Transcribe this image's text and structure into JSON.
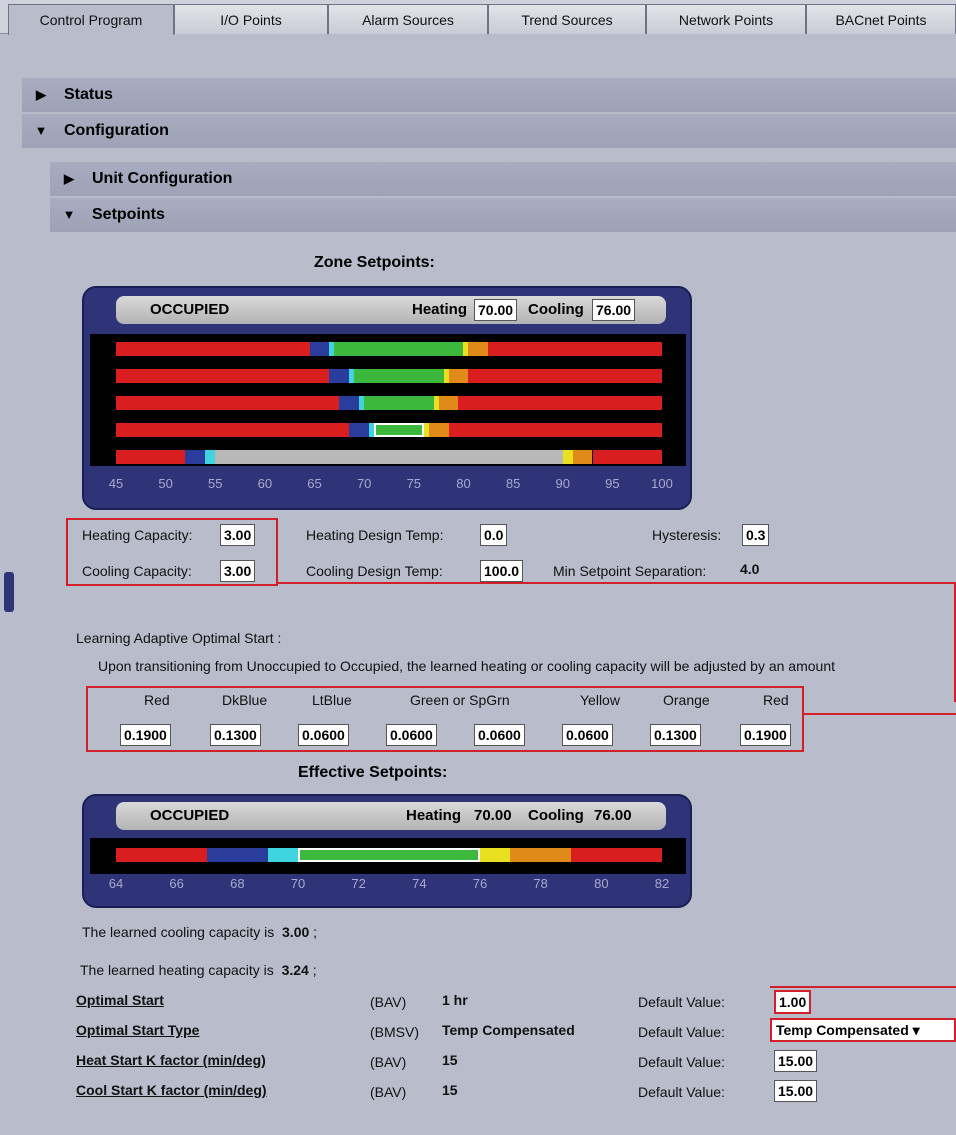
{
  "tabs": [
    "Control Program",
    "I/O Points",
    "Alarm Sources",
    "Trend Sources",
    "Network Points",
    "BACnet Points"
  ],
  "sections": {
    "status": "Status",
    "configuration": "Configuration",
    "unit_config": "Unit Configuration",
    "setpoints": "Setpoints"
  },
  "zone": {
    "title": "Zone Setpoints:",
    "mode": "OCCUPIED",
    "heating_label": "Heating",
    "heating": "70.00",
    "cooling_label": "Cooling",
    "cooling": "76.00",
    "ticks": [
      "45",
      "50",
      "55",
      "60",
      "65",
      "70",
      "75",
      "80",
      "85",
      "90",
      "95",
      "100"
    ],
    "axis_min": 45,
    "axis_max": 100,
    "rows": [
      {
        "segs": [
          [
            "red",
            45,
            64.5
          ],
          [
            "blue",
            64.5,
            66.5
          ],
          [
            "cyan",
            66.5,
            67
          ],
          [
            "green",
            67,
            80
          ],
          [
            "yellow",
            80,
            80.5
          ],
          [
            "orange",
            80.5,
            82.5
          ],
          [
            "red",
            82.5,
            100
          ]
        ]
      },
      {
        "segs": [
          [
            "red",
            45,
            66.5
          ],
          [
            "blue",
            66.5,
            68.5
          ],
          [
            "cyan",
            68.5,
            69
          ],
          [
            "green",
            69,
            78
          ],
          [
            "yellow",
            78,
            78.5
          ],
          [
            "orange",
            78.5,
            80.5
          ],
          [
            "red",
            80.5,
            100
          ]
        ]
      },
      {
        "segs": [
          [
            "red",
            45,
            67.5
          ],
          [
            "blue",
            67.5,
            69.5
          ],
          [
            "cyan",
            69.5,
            70
          ],
          [
            "green",
            70,
            77
          ],
          [
            "yellow",
            77,
            77.5
          ],
          [
            "orange",
            77.5,
            79.5
          ],
          [
            "red",
            79.5,
            100
          ]
        ]
      },
      {
        "segs": [
          [
            "red",
            45,
            68.5
          ],
          [
            "blue",
            68.5,
            70.5
          ],
          [
            "cyan",
            70.5,
            71
          ],
          [
            "green-outline",
            71,
            76
          ],
          [
            "yellow",
            76,
            76.5
          ],
          [
            "orange",
            76.5,
            78.5
          ],
          [
            "red",
            78.5,
            100
          ]
        ]
      },
      {
        "segs": [
          [
            "red",
            45,
            52
          ],
          [
            "blue",
            52,
            54
          ],
          [
            "cyan",
            54,
            55
          ],
          [
            "gray",
            55,
            90
          ],
          [
            "yellow",
            90,
            91
          ],
          [
            "orange",
            91,
            93
          ],
          [
            "red",
            93,
            100
          ]
        ]
      }
    ]
  },
  "capacity": {
    "heating_cap_label": "Heating Capacity:",
    "heating_cap": "3.00",
    "cooling_cap_label": "Cooling Capacity:",
    "cooling_cap": "3.00",
    "heating_design_label": "Heating Design Temp:",
    "heating_design": "0.0",
    "cooling_design_label": "Cooling Design Temp:",
    "cooling_design": "100.0",
    "hysteresis_label": "Hysteresis:",
    "hysteresis": "0.3",
    "min_sep_label": "Min Setpoint Separation:",
    "min_sep": "4.0"
  },
  "learning": {
    "title": "Learning Adaptive Optimal Start :",
    "desc": "Upon transitioning from Unoccupied to Occupied, the learned heating or cooling capacity will be adjusted by an amount",
    "columns": [
      "Red",
      "DkBlue",
      "LtBlue",
      "Green or SpGrn",
      "Yellow",
      "Orange",
      "Red"
    ],
    "values": [
      "0.1900",
      "0.1300",
      "0.0600",
      "0.0600",
      "0.0600",
      "0.0600",
      "0.1300",
      "0.1900"
    ]
  },
  "effective": {
    "title": "Effective Setpoints:",
    "mode": "OCCUPIED",
    "heating_label": "Heating",
    "heating": "70.00",
    "cooling_label": "Cooling",
    "cooling": "76.00",
    "ticks": [
      "64",
      "66",
      "68",
      "70",
      "72",
      "74",
      "76",
      "78",
      "80",
      "82"
    ],
    "axis_min": 64,
    "axis_max": 82,
    "segs": [
      [
        "red",
        64,
        67
      ],
      [
        "blue",
        67,
        69
      ],
      [
        "cyan",
        69,
        70
      ],
      [
        "green-outline",
        70,
        76
      ],
      [
        "yellow",
        76,
        77
      ],
      [
        "orange",
        77,
        79
      ],
      [
        "red",
        79,
        82
      ]
    ]
  },
  "learned": {
    "cooling_text": "The learned cooling capacity is",
    "cooling": "3.00",
    "heating_text": "The learned heating capacity is",
    "heating": "3.24",
    "sep": ";"
  },
  "params": [
    {
      "name": "Optimal Start",
      "type": "(BAV)",
      "value": "1 hr",
      "default_label": "Default Value:",
      "default": "1.00"
    },
    {
      "name": "Optimal Start Type",
      "type": "(BMSV)",
      "value": "Temp Compensated",
      "default_label": "Default Value:",
      "default": "Temp Compensated"
    },
    {
      "name": "Heat Start K factor (min/deg)",
      "type": "(BAV)",
      "value": "15",
      "default_label": "Default Value:",
      "default": "15.00"
    },
    {
      "name": "Cool Start K factor (min/deg)",
      "type": "(BAV)",
      "value": "15",
      "default_label": "Default Value:",
      "default": "15.00"
    }
  ],
  "colors": {
    "red": "#d81e1e",
    "blue": "#2a3d9c",
    "cyan": "#3fd5e0",
    "green": "#3cb83c",
    "yellow": "#e8e020",
    "orange": "#e08a1a",
    "gray": "#b8b8b8",
    "panel": "#2e3477"
  }
}
